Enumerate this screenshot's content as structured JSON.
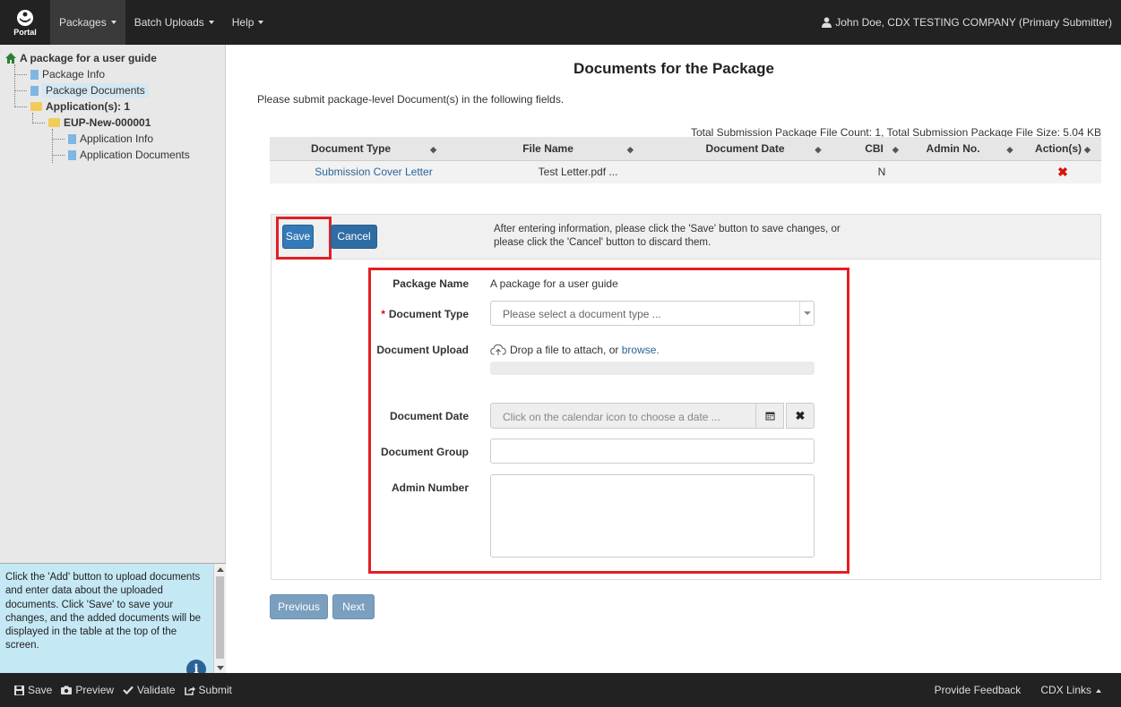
{
  "navbar": {
    "brand": "Portal",
    "menus": [
      {
        "label": "Packages"
      },
      {
        "label": "Batch Uploads"
      },
      {
        "label": "Help"
      }
    ],
    "user": "John Doe, CDX TESTING COMPANY (Primary Submitter)"
  },
  "sidebar": {
    "tree": {
      "root": "A package for a user guide",
      "package_info": "Package Info",
      "package_documents": "Package Documents",
      "applications": "Application(s): 1",
      "eup": "EUP-New-000001",
      "application_info": "Application Info",
      "application_documents": "Application Documents"
    },
    "help_text": "Click the 'Add' button to upload documents and enter data about the uploaded documents. Click 'Save' to save your changes, and the added documents will be displayed in the table at the top of the screen."
  },
  "main": {
    "title": "Documents for the Package",
    "intro": "Please submit package-level Document(s) in the following fields.",
    "totals": "Total Submission Package File Count: 1, Total Submission Package File Size: 5.04 KB",
    "table": {
      "headers": [
        "Document Type",
        "File Name",
        "Document Date",
        "CBI",
        "Admin No.",
        "Action(s)"
      ],
      "rows": [
        {
          "document_type": "Submission Cover Letter",
          "file_name": "Test Letter.pdf ...",
          "document_date": "",
          "cbi": "N",
          "admin_no": ""
        }
      ]
    },
    "form": {
      "save_label": "Save",
      "cancel_label": "Cancel",
      "head_message": "After entering information, please click the 'Save' button to save changes, or please click the 'Cancel' button to discard them.",
      "package_name_label": "Package Name",
      "package_name_value": "A package for a user guide",
      "document_type_label": "Document Type",
      "document_type_placeholder": "Please select a document type ...",
      "document_upload_label": "Document Upload",
      "upload_text": "Drop a file to attach, or",
      "upload_link": "browse.",
      "document_date_label": "Document Date",
      "document_date_placeholder": "Click on the calendar icon to choose a date ...",
      "document_group_label": "Document Group",
      "admin_number_label": "Admin Number"
    },
    "previous_label": "Previous",
    "next_label": "Next"
  },
  "bottombar": {
    "save": "Save",
    "preview": "Preview",
    "validate": "Validate",
    "submit": "Submit",
    "feedback": "Provide Feedback",
    "cdx_links": "CDX Links"
  },
  "colors": {
    "navbar_bg": "#222222",
    "link_blue": "#2a6496",
    "highlight_red": "#e21f26",
    "help_bg": "#c5e8f5"
  }
}
